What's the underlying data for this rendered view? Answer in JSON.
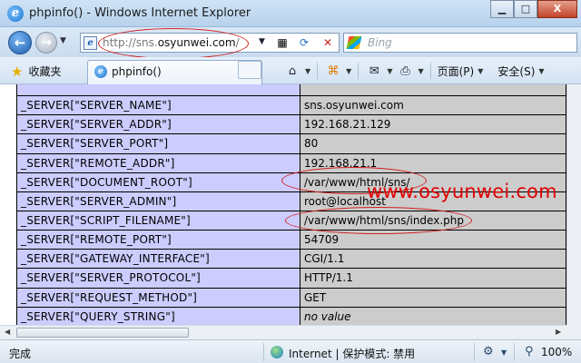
{
  "window": {
    "title": "phpinfo() - Windows Internet Explorer",
    "minimize_glyph": "▁",
    "maximize_glyph": "□",
    "close_glyph": "X"
  },
  "address_bar": {
    "url_prefix": "http://sns.",
    "url_domain": "osyunwei.com",
    "url_suffix": "/",
    "search_placeholder": "Bing"
  },
  "favorites": {
    "label": "收藏夹"
  },
  "tab": {
    "label": "phpinfo()"
  },
  "toolbar": {
    "page_label": "页面(P)",
    "safety_label": "安全(S)"
  },
  "server_table": {
    "rows": [
      {
        "key": "",
        "value": ""
      },
      {
        "key": "_SERVER[\"SERVER_NAME\"]",
        "value": "sns.osyunwei.com"
      },
      {
        "key": "_SERVER[\"SERVER_ADDR\"]",
        "value": "192.168.21.129"
      },
      {
        "key": "_SERVER[\"SERVER_PORT\"]",
        "value": "80"
      },
      {
        "key": "_SERVER[\"REMOTE_ADDR\"]",
        "value": "192.168.21.1"
      },
      {
        "key": "_SERVER[\"DOCUMENT_ROOT\"]",
        "value": "/var/www/html/sns/"
      },
      {
        "key": "_SERVER[\"SERVER_ADMIN\"]",
        "value": "root@localhost"
      },
      {
        "key": "_SERVER[\"SCRIPT_FILENAME\"]",
        "value": "/var/www/html/sns/index.php"
      },
      {
        "key": "_SERVER[\"REMOTE_PORT\"]",
        "value": "54709"
      },
      {
        "key": "_SERVER[\"GATEWAY_INTERFACE\"]",
        "value": "CGI/1.1"
      },
      {
        "key": "_SERVER[\"SERVER_PROTOCOL\"]",
        "value": "HTTP/1.1"
      },
      {
        "key": "_SERVER[\"REQUEST_METHOD\"]",
        "value": "GET"
      },
      {
        "key": "_SERVER[\"QUERY_STRING\"]",
        "value": "no value"
      }
    ]
  },
  "watermark": "www.osyunwei.com",
  "status_bar": {
    "status_text": "完成",
    "zone_text": "Internet | 保护模式: 禁用",
    "zoom_text": "100%"
  }
}
